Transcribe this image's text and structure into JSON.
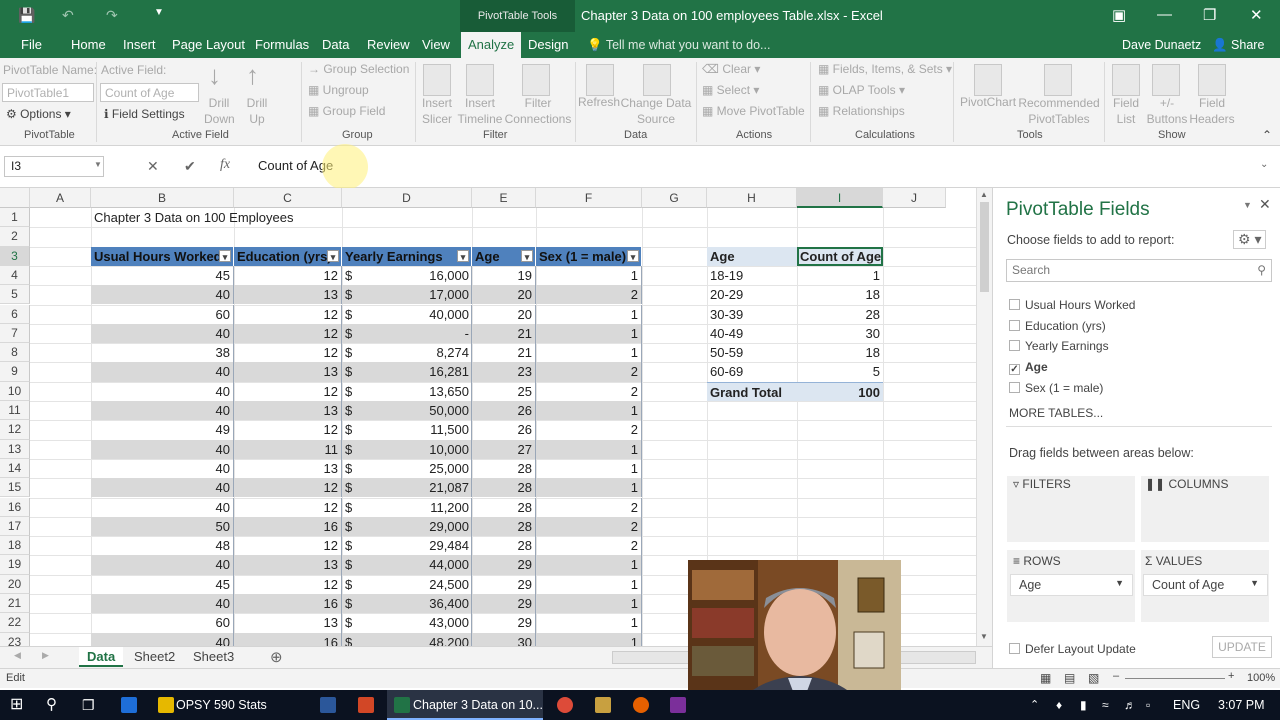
{
  "window": {
    "context_tab": "PivotTable Tools",
    "title": "Chapter 3 Data on 100 employees Table.xlsx - Excel",
    "user": "Dave Dunaetz",
    "share": "Share"
  },
  "tabs": [
    "File",
    "Home",
    "Insert",
    "Page Layout",
    "Formulas",
    "Data",
    "Review",
    "View",
    "Analyze",
    "Design"
  ],
  "tell_me": "Tell me what you want to do...",
  "ribbon": {
    "pt_name_label": "PivotTable Name:",
    "pt_name_value": "PivotTable1",
    "options": "Options",
    "group_pivottable": "PivotTable",
    "active_field_label": "Active Field:",
    "active_field_value": "Count of Age",
    "field_settings": "Field Settings",
    "drill_down": "Drill Down",
    "drill_up": "Drill Up",
    "group_active_field": "Active Field",
    "group_selection": "Group Selection",
    "ungroup": "Ungroup",
    "group_field": "Group Field",
    "group_group": "Group",
    "insert_slicer": "Insert Slicer",
    "insert_timeline": "Insert Timeline",
    "filter_connections": "Filter Connections",
    "group_filter": "Filter",
    "refresh": "Refresh",
    "change_data_source": "Change Data Source",
    "group_data": "Data",
    "clear": "Clear",
    "select": "Select",
    "move_pivottable": "Move PivotTable",
    "group_actions": "Actions",
    "fields_items_sets": "Fields, Items, & Sets",
    "olap_tools": "OLAP Tools",
    "relationships": "Relationships",
    "group_calculations": "Calculations",
    "pivotchart": "PivotChart",
    "recommended_pivottables": "Recommended PivotTables",
    "group_tools": "Tools",
    "field_list": "Field List",
    "buttons": "+/- Buttons",
    "field_headers": "Field Headers",
    "group_show": "Show"
  },
  "formula_bar": {
    "name_box": "I3",
    "content": "Count of Age"
  },
  "columns": [
    "A",
    "B",
    "C",
    "D",
    "E",
    "F",
    "G",
    "H",
    "I",
    "J"
  ],
  "rows": [
    "1",
    "2",
    "3",
    "4",
    "5",
    "6",
    "7",
    "8",
    "9",
    "10",
    "11",
    "12",
    "13",
    "14",
    "15",
    "16",
    "17",
    "18",
    "19",
    "20",
    "21",
    "22",
    "23"
  ],
  "sheet_title": "Chapter 3 Data on 100 Employees",
  "table": {
    "headers": [
      "Usual Hours Worked",
      "Education (yrs)",
      "Yearly Earnings",
      "Age",
      "Sex (1 = male)"
    ],
    "rows": [
      [
        "45",
        "12",
        "$",
        "16,000",
        "19",
        "1"
      ],
      [
        "40",
        "13",
        "$",
        "17,000",
        "20",
        "2"
      ],
      [
        "60",
        "12",
        "$",
        "40,000",
        "20",
        "1"
      ],
      [
        "40",
        "12",
        "$",
        "-",
        "21",
        "1"
      ],
      [
        "38",
        "12",
        "$",
        "8,274",
        "21",
        "1"
      ],
      [
        "40",
        "13",
        "$",
        "16,281",
        "23",
        "2"
      ],
      [
        "40",
        "12",
        "$",
        "13,650",
        "25",
        "2"
      ],
      [
        "40",
        "13",
        "$",
        "50,000",
        "26",
        "1"
      ],
      [
        "49",
        "12",
        "$",
        "11,500",
        "26",
        "2"
      ],
      [
        "40",
        "11",
        "$",
        "10,000",
        "27",
        "1"
      ],
      [
        "40",
        "13",
        "$",
        "25,000",
        "28",
        "1"
      ],
      [
        "40",
        "12",
        "$",
        "21,087",
        "28",
        "1"
      ],
      [
        "40",
        "12",
        "$",
        "11,200",
        "28",
        "2"
      ],
      [
        "50",
        "16",
        "$",
        "29,000",
        "28",
        "2"
      ],
      [
        "48",
        "12",
        "$",
        "29,484",
        "28",
        "2"
      ],
      [
        "40",
        "13",
        "$",
        "44,000",
        "29",
        "1"
      ],
      [
        "45",
        "12",
        "$",
        "24,500",
        "29",
        "1"
      ],
      [
        "40",
        "16",
        "$",
        "36,400",
        "29",
        "1"
      ],
      [
        "60",
        "13",
        "$",
        "43,000",
        "29",
        "1"
      ],
      [
        "40",
        "16",
        "$",
        "48,200",
        "30",
        "1"
      ]
    ]
  },
  "pivot": {
    "row_header": "Age",
    "value_header": "Count of Age",
    "rows": [
      [
        "18-19",
        "1"
      ],
      [
        "20-29",
        "18"
      ],
      [
        "30-39",
        "28"
      ],
      [
        "40-49",
        "30"
      ],
      [
        "50-59",
        "18"
      ],
      [
        "60-69",
        "5"
      ]
    ],
    "total_label": "Grand Total",
    "total_value": "100"
  },
  "sheet_tabs": [
    "Data",
    "Sheet2",
    "Sheet3"
  ],
  "status": "Edit",
  "pane": {
    "title": "PivotTable Fields",
    "choose": "Choose fields to add to report:",
    "search_placeholder": "Search",
    "fields": [
      {
        "label": "Usual Hours Worked",
        "checked": false
      },
      {
        "label": "Education (yrs)",
        "checked": false
      },
      {
        "label": "Yearly Earnings",
        "checked": false
      },
      {
        "label": "Age",
        "checked": true
      },
      {
        "label": "Sex (1 = male)",
        "checked": false
      }
    ],
    "more_tables": "MORE TABLES...",
    "drag_label": "Drag fields between areas below:",
    "filters": "FILTERS",
    "columns": "COLUMNS",
    "rows": "ROWS",
    "values": "VALUES",
    "rows_value": "Age",
    "values_value": "Count of Age",
    "defer": "Defer Layout Update",
    "update": "UPDATE"
  },
  "taskbar": {
    "items": [
      "OPSY 590 Stats",
      "Chapter 3 Data on 10..."
    ],
    "lang": "ENG",
    "time": "3:07 PM"
  },
  "zoom": "100%"
}
